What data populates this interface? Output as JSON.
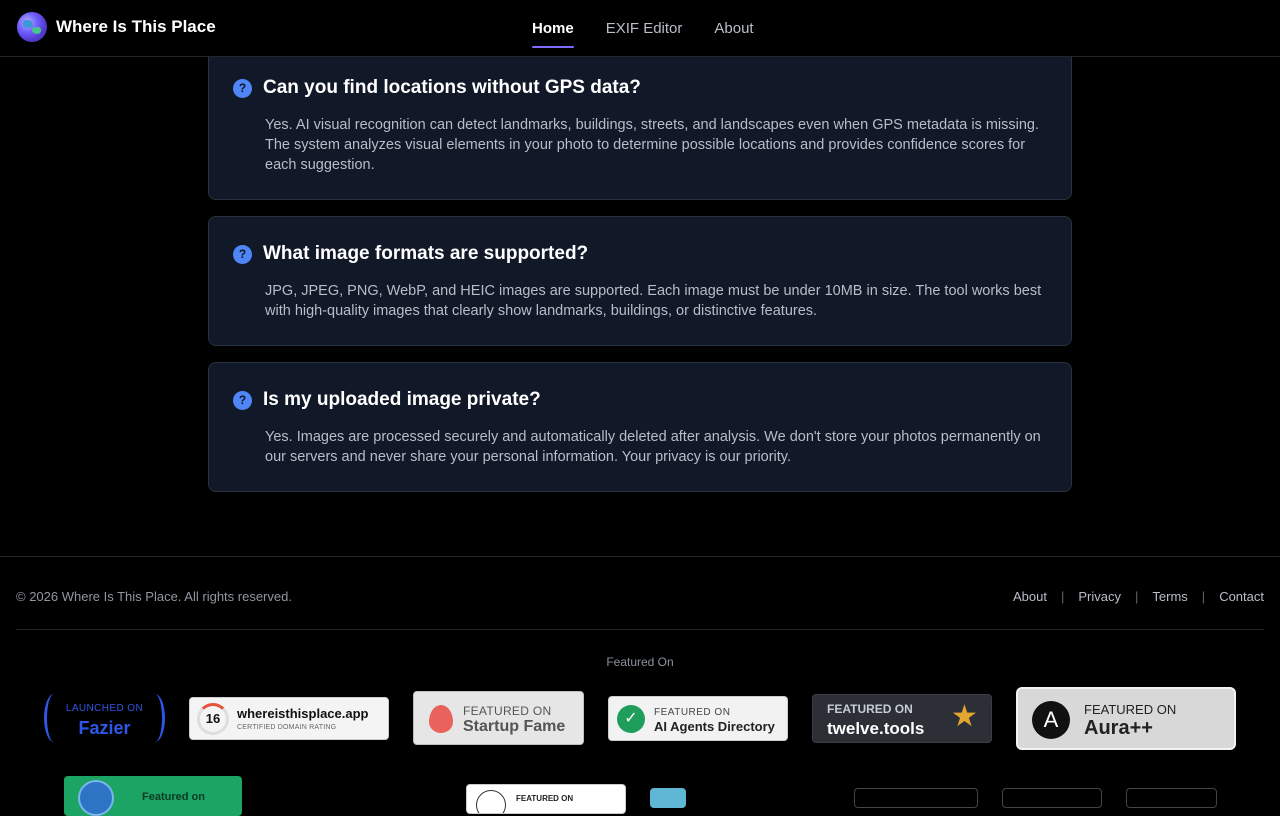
{
  "header": {
    "brand": "Where Is This Place",
    "nav": [
      {
        "label": "Home",
        "active": true
      },
      {
        "label": "EXIF Editor",
        "active": false
      },
      {
        "label": "About",
        "active": false
      }
    ]
  },
  "faq": [
    {
      "question": "Can you find locations without GPS data?",
      "answer": "Yes. AI visual recognition can detect landmarks, buildings, streets, and landscapes even when GPS metadata is missing. The system analyzes visual elements in your photo to determine possible locations and provides confidence scores for each suggestion."
    },
    {
      "question": "What image formats are supported?",
      "answer": "JPG, JPEG, PNG, WebP, and HEIC images are supported. Each image must be under 10MB in size. The tool works best with high-quality images that clearly show landmarks, buildings, or distinctive features."
    },
    {
      "question": "Is my uploaded image private?",
      "answer": "Yes. Images are processed securely and automatically deleted after analysis. We don't store your photos permanently on our servers and never share your personal information. Your privacy is our priority."
    }
  ],
  "faq_icon_glyph": "?",
  "footer": {
    "copyright": "© 2026 Where Is This Place. All rights reserved.",
    "links": [
      "About",
      "Privacy",
      "Terms",
      "Contact"
    ],
    "separator": "|",
    "featured_title": "Featured On"
  },
  "badges": {
    "fazier": {
      "small": "LAUNCHED ON",
      "big": "Fazier"
    },
    "domain": {
      "score": "16",
      "name": "whereisthisplace.app",
      "sub": "CERTIFIED DOMAIN RATING"
    },
    "startup_fame": {
      "small": "FEATURED ON",
      "big": "Startup Fame"
    },
    "ai_agents": {
      "small": "FEATURED ON",
      "big": "AI Agents Directory",
      "check": "✓"
    },
    "twelve_tools": {
      "small": "FEATURED ON",
      "big": "twelve.tools",
      "star": "★"
    },
    "aura": {
      "small": "FEATURED ON",
      "big": "Aura++",
      "letter": "A"
    },
    "green": {
      "text": "Featured on"
    },
    "small2": {
      "text": "FEATURED ON"
    }
  },
  "colors": {
    "accent": "#7f6dff",
    "faq_icon": "#4f86f7",
    "card_bg": "#111827"
  }
}
